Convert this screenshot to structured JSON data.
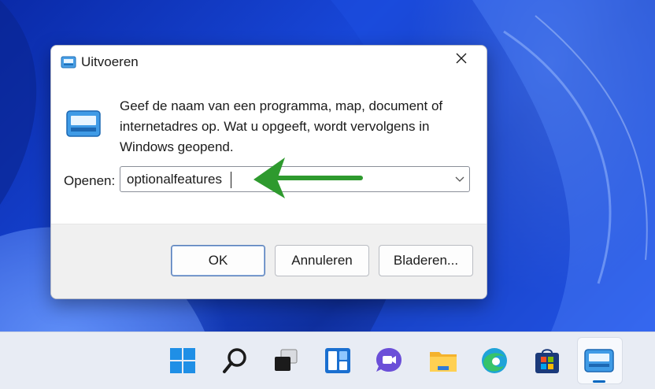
{
  "window": {
    "title": "Uitvoeren",
    "icon": "run-icon",
    "close_icon": "close-icon"
  },
  "dialog": {
    "description": "Geef de naam van een programma, map, document of internetadres op. Wat u opgeeft, wordt vervolgens in Windows geopend.",
    "open_label": "Openen:",
    "open_value": "optionalfeatures",
    "dropdown_icon": "chevron-down-icon",
    "buttons": {
      "ok": "OK",
      "cancel": "Annuleren",
      "browse": "Bladeren..."
    }
  },
  "annotation": {
    "arrow_color": "#2e9a2e"
  },
  "taskbar": {
    "items": [
      {
        "icon": "start-icon"
      },
      {
        "icon": "search-icon"
      },
      {
        "icon": "task-view-icon"
      },
      {
        "icon": "widgets-icon"
      },
      {
        "icon": "chat-icon"
      },
      {
        "icon": "file-explorer-icon"
      },
      {
        "icon": "edge-icon"
      },
      {
        "icon": "store-icon"
      },
      {
        "icon": "run-icon"
      }
    ],
    "accent": "#0067c0"
  }
}
